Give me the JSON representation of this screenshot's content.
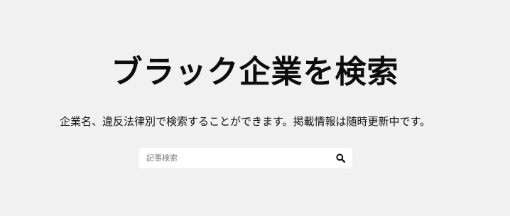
{
  "hero": {
    "title": "ブラック企業を検索",
    "subtitle": "企業名、違反法律別で検索することができます。掲載情報は随時更新中です。"
  },
  "search": {
    "placeholder": "記事検索",
    "value": "",
    "button_icon": "search-icon"
  },
  "colors": {
    "background": "#f1f1f1",
    "text": "#111111",
    "input_background": "#ffffff"
  }
}
